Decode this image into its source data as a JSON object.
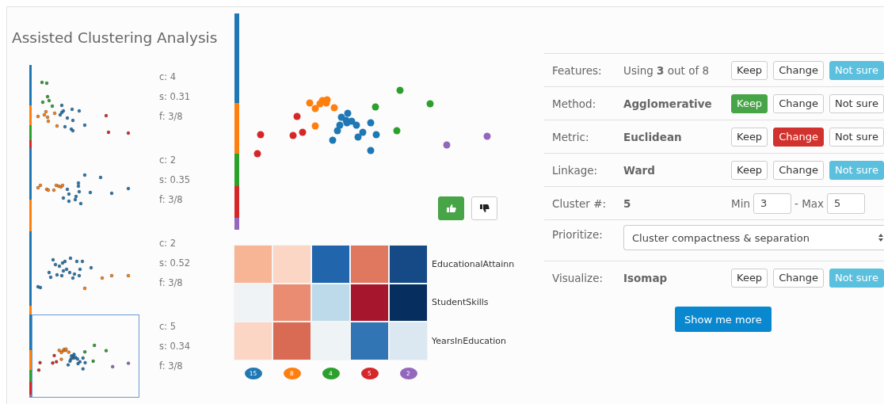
{
  "title": "Assisted Clustering Analysis",
  "thumbnails": [
    {
      "clusters": "c: 4",
      "silhouette": "s: 0.31",
      "features": "f: 3/8",
      "selected": false
    },
    {
      "clusters": "c: 2",
      "silhouette": "s: 0.35",
      "features": "f: 3/8",
      "selected": false
    },
    {
      "clusters": "c: 2",
      "silhouette": "s: 0.52",
      "features": "f: 3/8",
      "selected": false
    },
    {
      "clusters": "c: 5",
      "silhouette": "s: 0.34",
      "features": "f: 3/8",
      "selected": true
    }
  ],
  "feedback": [
    {
      "kind": "like",
      "selected": true
    },
    {
      "kind": "dislike",
      "selected": false
    }
  ],
  "heatmap": {
    "rows": [
      {
        "label": "EducationalAttainn",
        "cells": [
          {
            "color": "#f7b596"
          },
          {
            "color": "#fcd6c4"
          },
          {
            "color": "#2166ac"
          },
          {
            "color": "#e0775f"
          },
          {
            "color": "#164a86"
          }
        ]
      },
      {
        "label": "StudentSkills",
        "cells": [
          {
            "color": "#eff3f5"
          },
          {
            "color": "#ea8c71"
          },
          {
            "color": "#bcdaea"
          },
          {
            "color": "#a6172d"
          },
          {
            "color": "#062f5f"
          }
        ]
      },
      {
        "label": "YearsInEducation",
        "cells": [
          {
            "color": "#fcd6c4"
          },
          {
            "color": "#d96a54"
          },
          {
            "color": "#eef3f6"
          },
          {
            "color": "#3175b5"
          },
          {
            "color": "#dbe8f2"
          }
        ]
      }
    ]
  },
  "clusters": [
    {
      "count": "15",
      "color": "#1f77b4"
    },
    {
      "count": "8",
      "color": "#ff7f0e"
    },
    {
      "count": "4",
      "color": "#2ca02c"
    },
    {
      "count": "5",
      "color": "#d62728"
    },
    {
      "count": "2",
      "color": "#9467bd"
    }
  ],
  "settings": [
    {
      "kind": "choice",
      "label": "Features:",
      "value": "Using **3** out of 8",
      "bold": false,
      "options": [
        {
          "label": "Keep",
          "kind": "keep",
          "selected": false
        },
        {
          "label": "Change",
          "kind": "change",
          "selected": false
        },
        {
          "label": "Not sure",
          "kind": "unsure",
          "selected": true
        }
      ]
    },
    {
      "kind": "choice",
      "label": "Method:",
      "value": "Agglomerative",
      "bold": true,
      "options": [
        {
          "label": "Keep",
          "kind": "keep",
          "selected": true
        },
        {
          "label": "Change",
          "kind": "change",
          "selected": false
        },
        {
          "label": "Not sure",
          "kind": "unsure",
          "selected": false
        }
      ]
    },
    {
      "kind": "choice",
      "label": "Metric:",
      "value": "Euclidean",
      "bold": true,
      "options": [
        {
          "label": "Keep",
          "kind": "keep",
          "selected": false
        },
        {
          "label": "Change",
          "kind": "change",
          "selected": true
        },
        {
          "label": "Not sure",
          "kind": "unsure",
          "selected": false
        }
      ]
    },
    {
      "kind": "choice",
      "label": "Linkage:",
      "value": "Ward",
      "bold": true,
      "options": [
        {
          "label": "Keep",
          "kind": "keep",
          "selected": false
        },
        {
          "label": "Change",
          "kind": "change",
          "selected": false
        },
        {
          "label": "Not sure",
          "kind": "unsure",
          "selected": true
        }
      ]
    },
    {
      "kind": "range",
      "label": "Cluster #:",
      "value": "5",
      "bold": true,
      "min_label": "Min",
      "min": "3",
      "max_label": "- Max",
      "max": "5"
    },
    {
      "kind": "select",
      "label": "Prioritize:",
      "value": "Cluster compactness & separation"
    },
    {
      "kind": "choice",
      "label": "Visualize:",
      "value": "Isomap",
      "bold": true,
      "options": [
        {
          "label": "Keep",
          "kind": "keep",
          "selected": false
        },
        {
          "label": "Change",
          "kind": "change",
          "selected": false
        },
        {
          "label": "Not sure",
          "kind": "unsure",
          "selected": true
        }
      ]
    }
  ],
  "action_button": "Show me more"
}
